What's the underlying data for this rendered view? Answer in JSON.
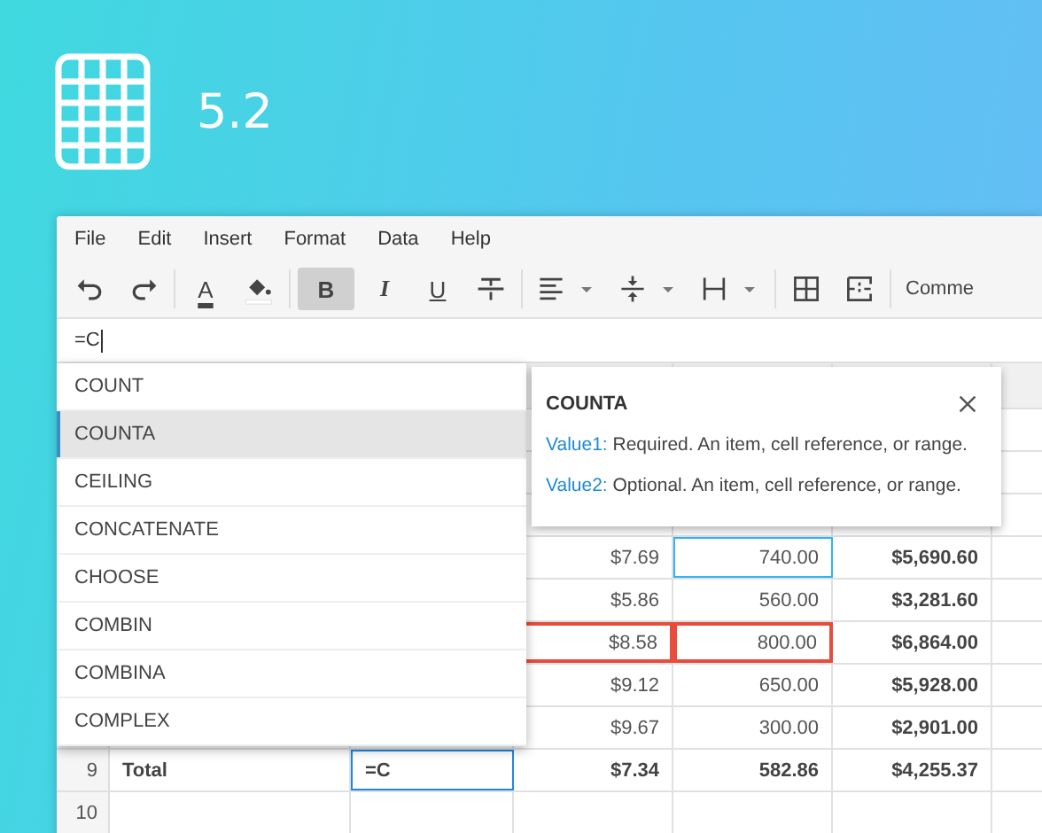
{
  "brand": {
    "version": "5.2"
  },
  "menu": [
    "File",
    "Edit",
    "Insert",
    "Format",
    "Data",
    "Help"
  ],
  "toolbar": [
    {
      "kind": "undo",
      "pressed": false
    },
    {
      "kind": "redo",
      "pressed": false
    },
    {
      "kind": "separator"
    },
    {
      "kind": "text-color",
      "label": "A",
      "pressed": false
    },
    {
      "kind": "fill-color",
      "pressed": false
    },
    {
      "kind": "separator"
    },
    {
      "kind": "bold",
      "label": "B",
      "pressed": true
    },
    {
      "kind": "italic",
      "label": "I",
      "pressed": false
    },
    {
      "kind": "underline",
      "label": "U",
      "pressed": false
    },
    {
      "kind": "strikethrough",
      "pressed": false
    },
    {
      "kind": "separator"
    },
    {
      "kind": "align",
      "pressed": false
    },
    {
      "kind": "valign",
      "pressed": false
    },
    {
      "kind": "wrap",
      "pressed": false
    },
    {
      "kind": "separator"
    },
    {
      "kind": "borders",
      "pressed": false
    },
    {
      "kind": "merge",
      "pressed": false
    },
    {
      "kind": "separator"
    },
    {
      "kind": "text",
      "label": "Comme",
      "pressed": false
    }
  ],
  "formula_bar": {
    "value": "=C"
  },
  "sheet": {
    "rows": [
      {
        "cells": [
          {
            "text": "$7.69",
            "bold": false,
            "focused": false,
            "invalid": false,
            "editing": false
          },
          {
            "text": "740.00",
            "bold": false,
            "focused": true,
            "invalid": false,
            "editing": false
          },
          {
            "text": "$5,690.60",
            "bold": true,
            "focused": false,
            "invalid": false,
            "editing": false
          }
        ]
      },
      {
        "cells": [
          {
            "text": "$5.86",
            "bold": false,
            "focused": false,
            "invalid": false,
            "editing": false
          },
          {
            "text": "560.00",
            "bold": false,
            "focused": false,
            "invalid": false,
            "editing": false
          },
          {
            "text": "$3,281.60",
            "bold": true,
            "focused": false,
            "invalid": false,
            "editing": false
          }
        ]
      },
      {
        "cells": [
          {
            "text": "$8.58",
            "bold": false,
            "focused": false,
            "invalid": true,
            "editing": false
          },
          {
            "text": "800.00",
            "bold": false,
            "focused": false,
            "invalid": true,
            "editing": false
          },
          {
            "text": "$6,864.00",
            "bold": true,
            "focused": false,
            "invalid": false,
            "editing": false
          }
        ]
      },
      {
        "cells": [
          {
            "text": "$9.12",
            "bold": false,
            "focused": false,
            "invalid": false,
            "editing": false
          },
          {
            "text": "650.00",
            "bold": false,
            "focused": false,
            "invalid": false,
            "editing": false
          },
          {
            "text": "$5,928.00",
            "bold": true,
            "focused": false,
            "invalid": false,
            "editing": false
          }
        ]
      },
      {
        "cells": [
          {
            "text": "$9.67",
            "bold": false,
            "focused": false,
            "invalid": false,
            "editing": false
          },
          {
            "text": "300.00",
            "bold": false,
            "focused": false,
            "invalid": false,
            "editing": false
          },
          {
            "text": "$2,901.00",
            "bold": true,
            "focused": false,
            "invalid": false,
            "editing": false
          }
        ]
      },
      {
        "number": "9",
        "cells": [
          {
            "text": "Total",
            "bold": true,
            "focused": false,
            "invalid": false,
            "editing": false
          },
          {
            "text": "=C",
            "bold": true,
            "focused": false,
            "invalid": false,
            "editing": true
          },
          {
            "text": "$7.34",
            "bold": true,
            "focused": false,
            "invalid": false,
            "editing": false
          },
          {
            "text": "582.86",
            "bold": true,
            "focused": false,
            "invalid": false,
            "editing": false
          },
          {
            "text": "$4,255.37",
            "bold": true,
            "focused": false,
            "invalid": false,
            "editing": false
          }
        ]
      },
      {
        "number": "10"
      }
    ]
  },
  "suggestions": [
    {
      "label": "COUNT",
      "selected": false
    },
    {
      "label": "COUNTA",
      "selected": true
    },
    {
      "label": "CEILING",
      "selected": false
    },
    {
      "label": "CONCATENATE",
      "selected": false
    },
    {
      "label": "CHOOSE",
      "selected": false
    },
    {
      "label": "COMBIN",
      "selected": false
    },
    {
      "label": "COMBINA",
      "selected": false
    },
    {
      "label": "COMPLEX",
      "selected": false
    }
  ],
  "help_tooltip": {
    "title": "COUNTA",
    "params": [
      {
        "name": "Value1:",
        "text": "Required. An item, cell reference, or range."
      },
      {
        "name": "Value2:",
        "text": "Optional. An item, cell reference, or range."
      }
    ]
  }
}
